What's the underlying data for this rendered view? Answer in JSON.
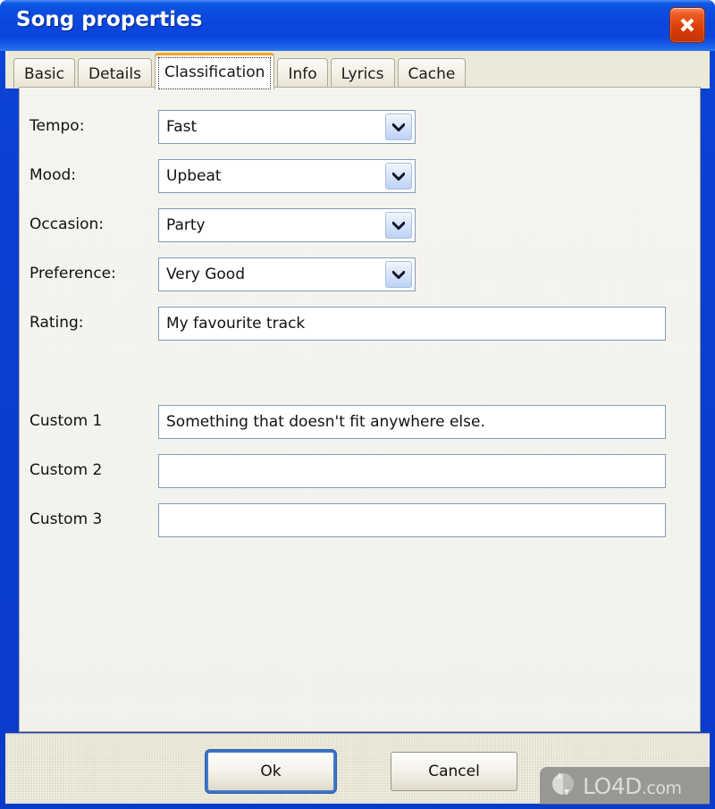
{
  "window": {
    "title": "Song properties",
    "close_icon": "close-x-icon",
    "accent_title_bar": "#0a46dd",
    "accent_active_tab": "#f5a623",
    "field_border": "#7f9db9",
    "panel_bg": "#f5f4ef",
    "buttonbar_bg": "#e4e0cf"
  },
  "tabs": [
    {
      "label": "Basic",
      "active": false
    },
    {
      "label": "Details",
      "active": false
    },
    {
      "label": "Classification",
      "active": true
    },
    {
      "label": "Info",
      "active": false
    },
    {
      "label": "Lyrics",
      "active": false
    },
    {
      "label": "Cache",
      "active": false
    }
  ],
  "form": {
    "dropdowns": [
      {
        "label": "Tempo:",
        "value": "Fast",
        "icon": "chevron-down-icon"
      },
      {
        "label": "Mood:",
        "value": "Upbeat",
        "icon": "chevron-down-icon"
      },
      {
        "label": "Occasion:",
        "value": "Party",
        "icon": "chevron-down-icon"
      },
      {
        "label": "Preference:",
        "value": "Very Good",
        "icon": "chevron-down-icon"
      }
    ],
    "rating": {
      "label": "Rating:",
      "value": "My favourite track",
      "placeholder": ""
    },
    "custom": [
      {
        "label": "Custom 1",
        "value": "Something that doesn't fit anywhere else.",
        "placeholder": ""
      },
      {
        "label": "Custom 2",
        "value": "",
        "placeholder": ""
      },
      {
        "label": "Custom 3",
        "value": "",
        "placeholder": ""
      }
    ]
  },
  "buttons": {
    "ok": "Ok",
    "cancel": "Cancel"
  },
  "watermark": {
    "brand": "LO4D",
    "suffix": ".com",
    "icon": "circular-arrows-icon"
  }
}
